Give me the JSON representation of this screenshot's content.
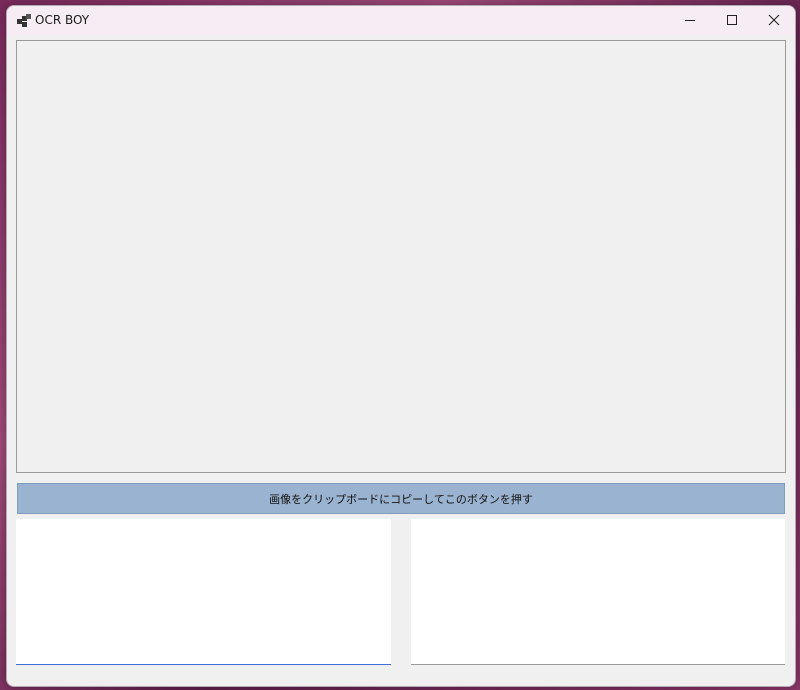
{
  "window": {
    "title": "OCR BOY",
    "app_icon": "windows-app-icon",
    "controls": {
      "minimize_icon": "minimize-icon",
      "maximize_icon": "maximize-icon",
      "close_icon": "close-icon"
    }
  },
  "main": {
    "ocr_button_label": "画像をクリップボードにコピーしてこのボタンを押す",
    "left_text": "",
    "right_text": ""
  },
  "colors": {
    "button_bg": "#9ab3d0",
    "focus_underline": "#3d6fd6",
    "panel_bg": "#f0f0f0"
  }
}
